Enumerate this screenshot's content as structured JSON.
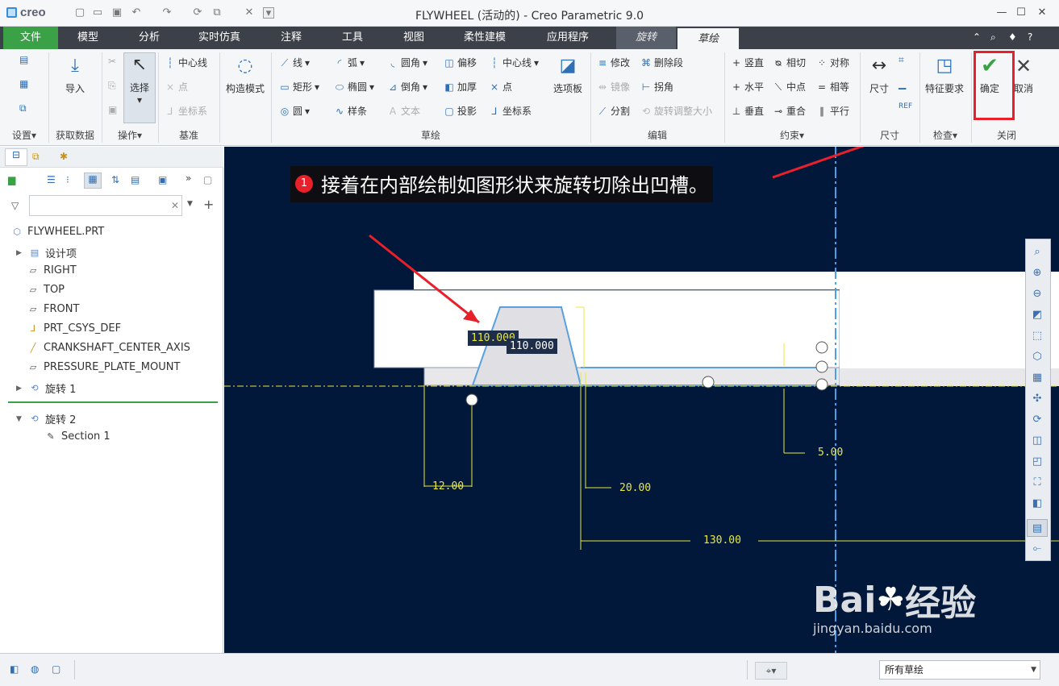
{
  "window": {
    "logo": "creo",
    "title": "FLYWHEEL (活动的) - Creo Parametric 9.0"
  },
  "menu": {
    "tabs": [
      "文件",
      "模型",
      "分析",
      "实时仿真",
      "注释",
      "工具",
      "视图",
      "柔性建模",
      "应用程序",
      "旋转",
      "草绘"
    ]
  },
  "ribbon": {
    "groups": {
      "settings": "设置",
      "get_data": "获取数据",
      "operations": "操作",
      "datum": "基准",
      "sketch": "草绘",
      "edit": "编辑",
      "constrain": "约束",
      "dimension": "尺寸",
      "inspect": "检查",
      "close": "关闭"
    },
    "import": "导入",
    "select": "选择",
    "centerline": "中心线",
    "point": "点",
    "csys": "坐标系",
    "construction": "构造模式",
    "line": "线",
    "rectangle": "矩形",
    "circle": "圆",
    "arc": "弧",
    "ellipse": "椭圆",
    "spline": "样条",
    "fillet": "圆角",
    "chamfer": "倒角",
    "text": "文本",
    "offset": "偏移",
    "thicken": "加厚",
    "project": "投影",
    "centerline2": "中心线",
    "point2": "点",
    "csys2": "坐标系",
    "palette": "选项板",
    "modify": "修改",
    "delete_segment": "删除段",
    "mirror": "镜像",
    "corner": "拐角",
    "divide": "分割",
    "rotate_resize": "旋转调整大小",
    "vertical": "竖直",
    "tangent": "相切",
    "symmetric": "对称",
    "horizontal": "水平",
    "midpoint": "中点",
    "equal": "相等",
    "perpendicular": "垂直",
    "coincident": "重合",
    "parallel": "平行",
    "dimension": "尺寸",
    "feature_req": "特征要求",
    "ok": "确定",
    "cancel": "取消"
  },
  "tree": {
    "search_placeholder": "",
    "items": [
      "FLYWHEEL.PRT",
      "设计项",
      "RIGHT",
      "TOP",
      "FRONT",
      "PRT_CSYS_DEF",
      "CRANKSHAFT_CENTER_AXIS",
      "PRESSURE_PLATE_MOUNT",
      "旋转 1",
      "旋转 2",
      "Section 1"
    ]
  },
  "canvas": {
    "annotation_num": "1",
    "annotation": "接着在内部绘制如图形状来旋转切除出凹槽。",
    "dims": {
      "d1": "110.000",
      "d2": "110.000",
      "d3": "12.00",
      "d4": "20.00",
      "d5": "5.00",
      "d6": "130.00"
    }
  },
  "status": {
    "filter": "所有草绘"
  },
  "watermark": {
    "brand": "Bai",
    "brand2": "经验",
    "url": "jingyan.baidu.com"
  },
  "colors": {
    "accent_green": "#3aa146",
    "highlight_red": "#e8202a",
    "canvas_bg": "#02183a",
    "dim_yellow": "#e8e83a"
  }
}
